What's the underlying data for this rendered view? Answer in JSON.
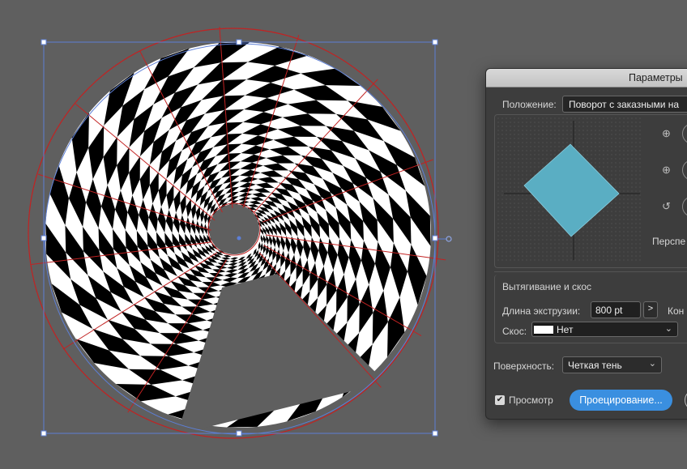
{
  "dialog": {
    "title": "Параметры",
    "position": {
      "label": "Положение:",
      "value": "Поворот с заказными на"
    },
    "perspective_label": "Перспе",
    "extrude_bevel": {
      "section_label": "Вытягивание и скос",
      "depth_label": "Длина экструзии:",
      "depth_value": "800 pt",
      "depth_arrow": ">",
      "cap_label": "Кон",
      "bevel_label": "Скос:",
      "bevel_value": "Нет"
    },
    "surface": {
      "label": "Поверхность:",
      "value": "Четкая тень"
    },
    "preview_label": "Просмотр",
    "map_art_button": "Проецирование...",
    "icons": [
      "rotate-x-icon",
      "rotate-y-icon",
      "rotate-z-icon",
      "checkmark-icon",
      "chevron-down-icon"
    ]
  },
  "colors": {
    "cube_face": "#5aaec3",
    "selection": "#5d7fd6",
    "mesh_lines": "#c22222",
    "accent_button": "#3a8fe0"
  }
}
